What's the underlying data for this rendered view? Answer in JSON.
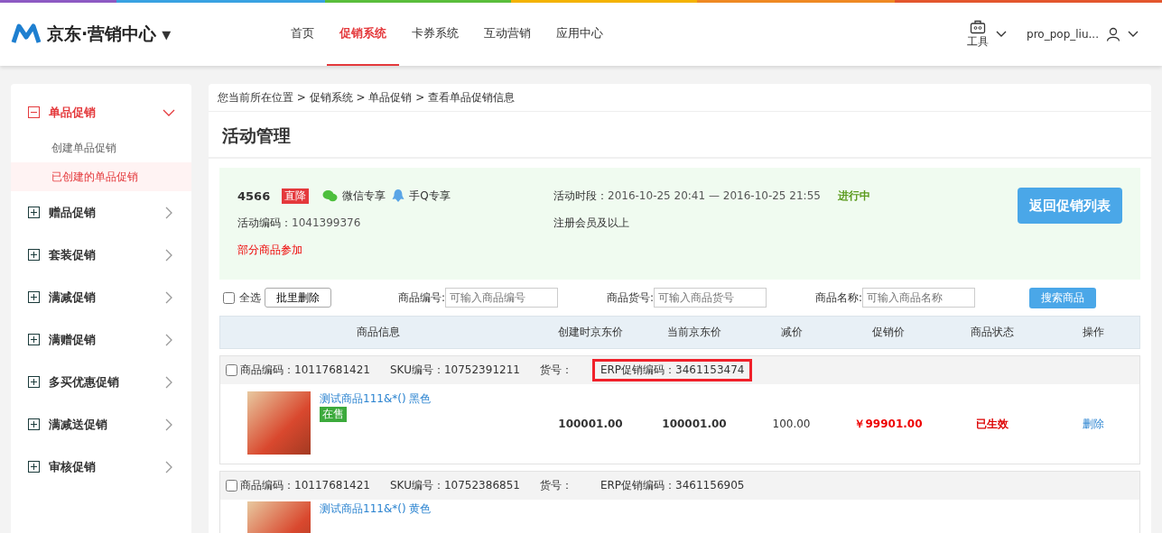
{
  "header": {
    "logo": "京东·营销中心",
    "logo_caret": "▼",
    "nav": [
      {
        "label": "首页",
        "selected": false
      },
      {
        "label": "促销系统",
        "selected": true
      },
      {
        "label": "卡券系统",
        "selected": false
      },
      {
        "label": "互动营销",
        "selected": false
      },
      {
        "label": "应用中心",
        "selected": false
      }
    ],
    "tools": "工具",
    "user": "pro_pop_liu..."
  },
  "sidebar": [
    {
      "label": "单品促销",
      "expanded": true,
      "children": [
        {
          "label": "创建单品促销",
          "selected": false
        },
        {
          "label": "已创建的单品促销",
          "selected": true
        }
      ]
    },
    {
      "label": "赠品促销",
      "expanded": false
    },
    {
      "label": "套装促销",
      "expanded": false
    },
    {
      "label": "满减促销",
      "expanded": false
    },
    {
      "label": "满赠促销",
      "expanded": false
    },
    {
      "label": "多买优惠促销",
      "expanded": false
    },
    {
      "label": "满减送促销",
      "expanded": false
    },
    {
      "label": "审核促销",
      "expanded": false
    }
  ],
  "breadcrumb": "您当前所在位置 > 促销系统 > 单品促销 > 查看单品促销信息",
  "page_title": "活动管理",
  "activity": {
    "id": "4566",
    "tag": "直降",
    "channels": [
      {
        "kind": "wechat",
        "label": "微信专享"
      },
      {
        "kind": "qq",
        "label": "手Q专享"
      }
    ],
    "code_label": "活动编码：",
    "code": "1041399376",
    "scope": "部分商品参加",
    "period_label": "活动时段：",
    "period": "2016-10-25 20:41 — 2016-10-25 21:55",
    "status": "进行中",
    "member": "注册会员及以上",
    "back_button": "返回促销列表"
  },
  "filters": {
    "select_all": {
      "label": "全选",
      "checked": false
    },
    "batch_delete": "批里删除",
    "fields": [
      {
        "label": "商品编号:",
        "placeholder": "可输入商品编号"
      },
      {
        "label": "商品货号:",
        "placeholder": "可输入商品货号"
      },
      {
        "label": "商品名称:",
        "placeholder": "可输入商品名称"
      }
    ],
    "search_button": "搜索商品"
  },
  "table": {
    "columns": [
      "商品信息",
      "创建时京东价",
      "当前京东价",
      "减价",
      "促销价",
      "商品状态",
      "操作"
    ],
    "rows": [
      {
        "checked": false,
        "product_code": "商品编码：10117681421",
        "sku": "SKU编号：10752391211",
        "item_no": "货号：",
        "erp_code": "ERP促销编码：3461153474",
        "highlighted": true,
        "title": "测试商品111&*() 黑色",
        "badge": "在售",
        "created_price": "100001.00",
        "current_price": "100001.00",
        "discount": "100.00",
        "promo_price": "￥99901.00",
        "state": "已生效",
        "action": "删除"
      },
      {
        "checked": false,
        "product_code": "商品编码：10117681421",
        "sku": "SKU编号：10752386851",
        "item_no": "货号：",
        "erp_code": "ERP促销编码：3461156905",
        "highlighted": false,
        "title": "测试商品111&*() 黄色"
      }
    ]
  }
}
